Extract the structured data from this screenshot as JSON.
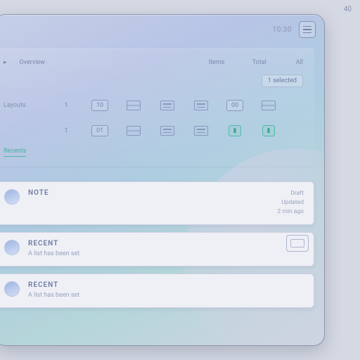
{
  "corner": "40",
  "titlebar": {
    "time": "10:30"
  },
  "panel": {
    "headers": {
      "col1": "Overview",
      "col2": "Items",
      "col3": "Total",
      "right": "All"
    },
    "chip": "1 selected",
    "rows": [
      {
        "label": "Layouts",
        "cells": [
          "1",
          "10",
          "",
          "",
          "",
          "00",
          ""
        ]
      },
      {
        "label": "",
        "cells": [
          "1",
          "01",
          "",
          "",
          "",
          "",
          ""
        ]
      }
    ],
    "tabs": {
      "a": "Recents",
      "b": ""
    }
  },
  "cards": [
    {
      "title": "NOTE",
      "sub": "",
      "meta1": "Draft",
      "meta2": "Updated",
      "meta3": "2 min ago"
    },
    {
      "title": "RECENT",
      "sub": "A list has been set",
      "meta1": "",
      "meta2": "",
      "meta3": ""
    },
    {
      "title": "RECENT",
      "sub": "A list has been set",
      "meta1": "",
      "meta2": "",
      "meta3": ""
    }
  ]
}
